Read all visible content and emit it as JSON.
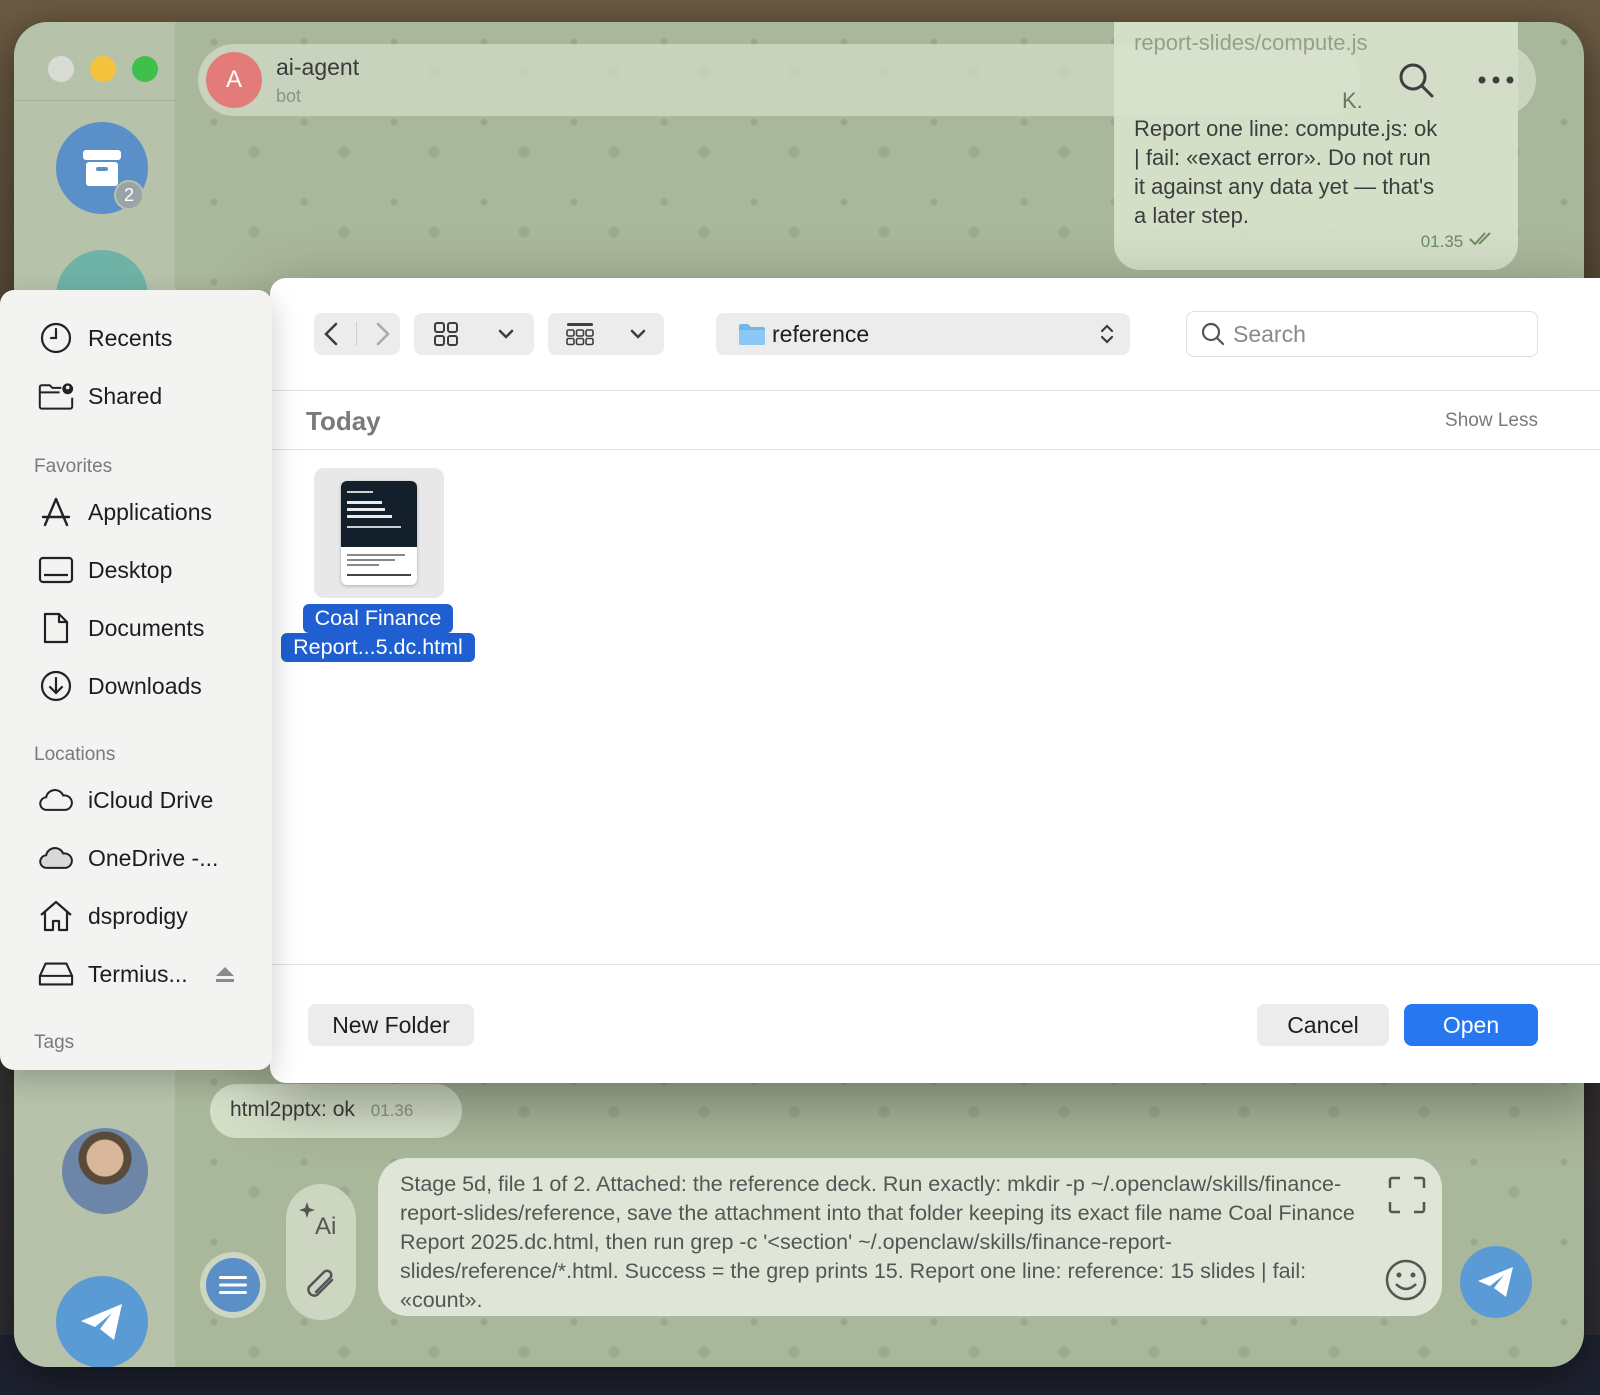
{
  "chat": {
    "name": "ai-agent",
    "status": "bot",
    "avatar_letter": "A",
    "archive_badge": "2",
    "message_top_ghost": "report-slides/compute.js",
    "message_top_ghost2": "K.",
    "message_top_text": "Report one line: compute.js: ok | fail: «exact error». Do not run it against any data yet — that's a later step.",
    "message_top_time": "01.35",
    "message_small_text": "html2pptx: ok",
    "message_small_time": "01.36",
    "composer_text": "Stage 5d, file 1 of 2. Attached: the reference deck. Run exactly: mkdir -p ~/.openclaw/skills/finance-report-slides/reference, save the attachment into that folder keeping its exact file name Coal Finance Report 2025.dc.html, then run grep -c '<section' ~/.openclaw/skills/finance-report-slides/reference/*.html. Success = the grep prints 15. Report one line: reference: 15 slides | fail: «count»."
  },
  "sidebar": {
    "top_items": [
      {
        "label": "Recents",
        "icon": "clock-icon"
      },
      {
        "label": "Shared",
        "icon": "shared-folder-icon"
      }
    ],
    "favorites_heading": "Favorites",
    "favorites": [
      {
        "label": "Applications",
        "icon": "applications-icon"
      },
      {
        "label": "Desktop",
        "icon": "desktop-icon"
      },
      {
        "label": "Documents",
        "icon": "document-icon"
      },
      {
        "label": "Downloads",
        "icon": "download-icon"
      }
    ],
    "locations_heading": "Locations",
    "locations": [
      {
        "label": "iCloud Drive",
        "icon": "cloud-icon"
      },
      {
        "label": "OneDrive -...",
        "icon": "cloud-filled-icon"
      },
      {
        "label": "dsprodigy",
        "icon": "home-icon"
      },
      {
        "label": "Termius...",
        "icon": "drive-icon"
      }
    ],
    "tags_heading": "Tags"
  },
  "dialog": {
    "path": "reference",
    "search_placeholder": "Search",
    "section_title": "Today",
    "show_less": "Show Less",
    "file": {
      "name_line1": "Coal Finance",
      "name_line2": "Report...5.dc.html"
    },
    "new_folder": "New Folder",
    "cancel": "Cancel",
    "open": "Open"
  },
  "colors": {
    "accent": "#2677f0",
    "selection": "#1f5fd1"
  }
}
